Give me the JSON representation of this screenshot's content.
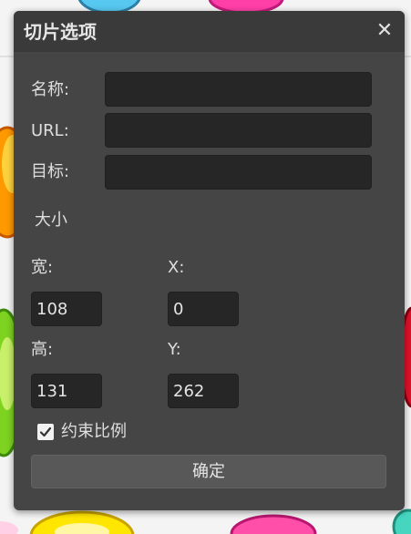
{
  "dialog": {
    "title": "切片选项",
    "close_glyph": "✕",
    "name_label": "名称:",
    "name_value": "",
    "url_label": "URL:",
    "url_value": "",
    "target_label": "目标:",
    "target_value": "",
    "size_section": "大小",
    "width_label": "宽:",
    "width_value": "108",
    "x_label": "X:",
    "x_value": "0",
    "height_label": "高:",
    "height_value": "131",
    "y_label": "Y:",
    "y_value": "262",
    "constrain_label": "约束比例",
    "constrain_checked": true,
    "ok_label": "确定"
  },
  "colors": {
    "dialog_bg": "#454545",
    "titlebar_bg": "#3a3a3a",
    "input_bg": "#262626",
    "button_bg": "#585858"
  },
  "icons": {
    "close": "close-icon",
    "check": "checkmark-icon"
  }
}
